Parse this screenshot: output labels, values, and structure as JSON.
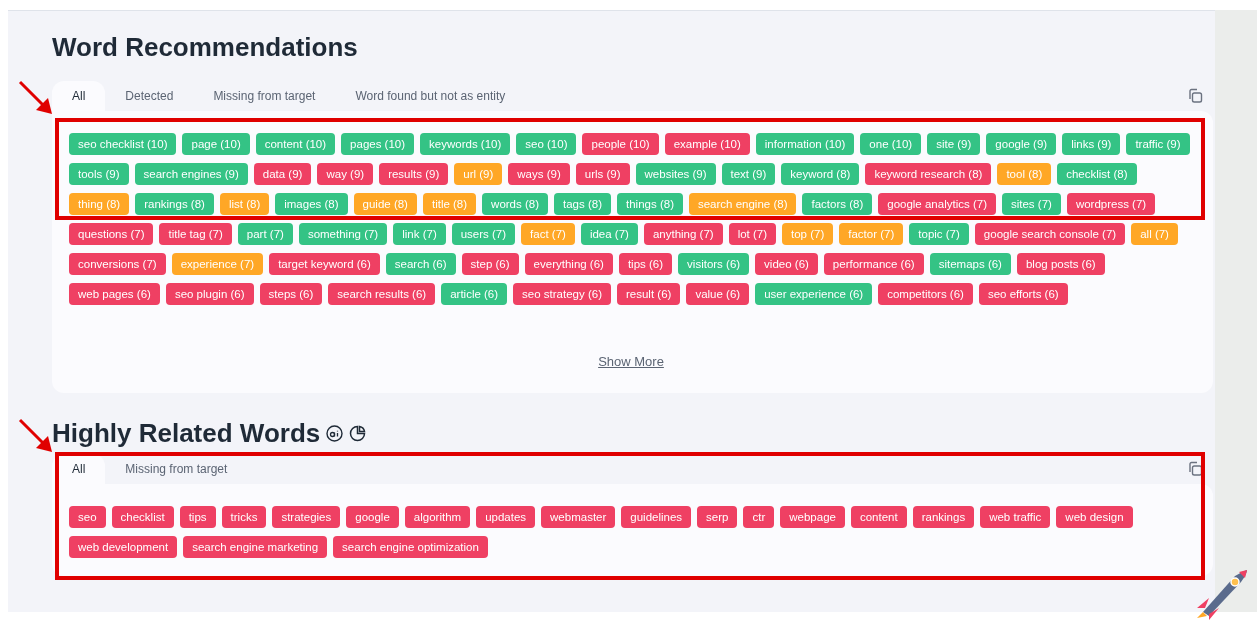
{
  "word_recommendations": {
    "title": "Word Recommendations",
    "tabs": [
      {
        "label": "All",
        "selected": true
      },
      {
        "label": "Detected",
        "selected": false
      },
      {
        "label": "Missing from target",
        "selected": false
      },
      {
        "label": "Word found but not as entity",
        "selected": false
      }
    ],
    "tags": [
      {
        "label": "seo checklist (10)",
        "color": "#34c385"
      },
      {
        "label": "page (10)",
        "color": "#34c385"
      },
      {
        "label": "content (10)",
        "color": "#34c385"
      },
      {
        "label": "pages (10)",
        "color": "#34c385"
      },
      {
        "label": "keywords (10)",
        "color": "#34c385"
      },
      {
        "label": "seo (10)",
        "color": "#34c385"
      },
      {
        "label": "people (10)",
        "color": "#ef4063"
      },
      {
        "label": "example (10)",
        "color": "#ef4063"
      },
      {
        "label": "information (10)",
        "color": "#34c385"
      },
      {
        "label": "one (10)",
        "color": "#34c385"
      },
      {
        "label": "site (9)",
        "color": "#34c385"
      },
      {
        "label": "google (9)",
        "color": "#34c385"
      },
      {
        "label": "links (9)",
        "color": "#34c385"
      },
      {
        "label": "traffic (9)",
        "color": "#34c385"
      },
      {
        "label": "tools (9)",
        "color": "#34c385"
      },
      {
        "label": "search engines (9)",
        "color": "#34c385"
      },
      {
        "label": "data (9)",
        "color": "#ef4063"
      },
      {
        "label": "way (9)",
        "color": "#ef4063"
      },
      {
        "label": "results (9)",
        "color": "#ef4063"
      },
      {
        "label": "url (9)",
        "color": "#ffa726"
      },
      {
        "label": "ways (9)",
        "color": "#ef4063"
      },
      {
        "label": "urls (9)",
        "color": "#ef4063"
      },
      {
        "label": "websites (9)",
        "color": "#34c385"
      },
      {
        "label": "text (9)",
        "color": "#34c385"
      },
      {
        "label": "keyword (8)",
        "color": "#34c385"
      },
      {
        "label": "keyword research (8)",
        "color": "#ef4063"
      },
      {
        "label": "tool (8)",
        "color": "#ffa726"
      },
      {
        "label": "checklist (8)",
        "color": "#34c385"
      },
      {
        "label": "thing (8)",
        "color": "#ffa726"
      },
      {
        "label": "rankings (8)",
        "color": "#34c385"
      },
      {
        "label": "list (8)",
        "color": "#ffa726"
      },
      {
        "label": "images (8)",
        "color": "#34c385"
      },
      {
        "label": "guide (8)",
        "color": "#ffa726"
      },
      {
        "label": "title (8)",
        "color": "#ffa726"
      },
      {
        "label": "words (8)",
        "color": "#34c385"
      },
      {
        "label": "tags (8)",
        "color": "#34c385"
      },
      {
        "label": "things (8)",
        "color": "#34c385"
      },
      {
        "label": "search engine (8)",
        "color": "#ffa726"
      },
      {
        "label": "factors (8)",
        "color": "#34c385"
      },
      {
        "label": "google analytics (7)",
        "color": "#ef4063"
      },
      {
        "label": "sites (7)",
        "color": "#34c385"
      },
      {
        "label": "wordpress (7)",
        "color": "#ef4063"
      },
      {
        "label": "questions (7)",
        "color": "#ef4063"
      },
      {
        "label": "title tag (7)",
        "color": "#ef4063"
      },
      {
        "label": "part (7)",
        "color": "#34c385"
      },
      {
        "label": "something (7)",
        "color": "#34c385"
      },
      {
        "label": "link (7)",
        "color": "#34c385"
      },
      {
        "label": "users (7)",
        "color": "#34c385"
      },
      {
        "label": "fact (7)",
        "color": "#ffa726"
      },
      {
        "label": "idea (7)",
        "color": "#34c385"
      },
      {
        "label": "anything (7)",
        "color": "#ef4063"
      },
      {
        "label": "lot (7)",
        "color": "#ef4063"
      },
      {
        "label": "top (7)",
        "color": "#ffa726"
      },
      {
        "label": "factor (7)",
        "color": "#ffa726"
      },
      {
        "label": "topic (7)",
        "color": "#34c385"
      },
      {
        "label": "google search console (7)",
        "color": "#ef4063"
      },
      {
        "label": "all (7)",
        "color": "#ffa726"
      },
      {
        "label": "conversions (7)",
        "color": "#ef4063"
      },
      {
        "label": "experience (7)",
        "color": "#ffa726"
      },
      {
        "label": "target keyword (6)",
        "color": "#ef4063"
      },
      {
        "label": "search (6)",
        "color": "#34c385"
      },
      {
        "label": "step (6)",
        "color": "#ef4063"
      },
      {
        "label": "everything (6)",
        "color": "#ef4063"
      },
      {
        "label": "tips (6)",
        "color": "#ef4063"
      },
      {
        "label": "visitors (6)",
        "color": "#34c385"
      },
      {
        "label": "video (6)",
        "color": "#ef4063"
      },
      {
        "label": "performance (6)",
        "color": "#ef4063"
      },
      {
        "label": "sitemaps (6)",
        "color": "#34c385"
      },
      {
        "label": "blog posts (6)",
        "color": "#ef4063"
      },
      {
        "label": "web pages (6)",
        "color": "#ef4063"
      },
      {
        "label": "seo plugin (6)",
        "color": "#ef4063"
      },
      {
        "label": "steps (6)",
        "color": "#ef4063"
      },
      {
        "label": "search results (6)",
        "color": "#ef4063"
      },
      {
        "label": "article (6)",
        "color": "#34c385"
      },
      {
        "label": "seo strategy (6)",
        "color": "#ef4063"
      },
      {
        "label": "result (6)",
        "color": "#ef4063"
      },
      {
        "label": "value (6)",
        "color": "#ef4063"
      },
      {
        "label": "user experience (6)",
        "color": "#34c385"
      },
      {
        "label": "competitors (6)",
        "color": "#ef4063"
      },
      {
        "label": "seo efforts (6)",
        "color": "#ef4063"
      }
    ],
    "show_more": "Show More"
  },
  "highly_related_words": {
    "title": "Highly Related Words",
    "tabs": [
      {
        "label": "All",
        "selected": true
      },
      {
        "label": "Missing from target",
        "selected": false
      }
    ],
    "tags": [
      {
        "label": "seo",
        "color": "#ef4063"
      },
      {
        "label": "checklist",
        "color": "#ef4063"
      },
      {
        "label": "tips",
        "color": "#ef4063"
      },
      {
        "label": "tricks",
        "color": "#ef4063"
      },
      {
        "label": "strategies",
        "color": "#ef4063"
      },
      {
        "label": "google",
        "color": "#ef4063"
      },
      {
        "label": "algorithm",
        "color": "#ef4063"
      },
      {
        "label": "updates",
        "color": "#ef4063"
      },
      {
        "label": "webmaster",
        "color": "#ef4063"
      },
      {
        "label": "guidelines",
        "color": "#ef4063"
      },
      {
        "label": "serp",
        "color": "#ef4063"
      },
      {
        "label": "ctr",
        "color": "#ef4063"
      },
      {
        "label": "webpage",
        "color": "#ef4063"
      },
      {
        "label": "content",
        "color": "#ef4063"
      },
      {
        "label": "rankings",
        "color": "#ef4063"
      },
      {
        "label": "web traffic",
        "color": "#ef4063"
      },
      {
        "label": "web design",
        "color": "#ef4063"
      },
      {
        "label": "web development",
        "color": "#ef4063"
      },
      {
        "label": "search engine marketing",
        "color": "#ef4063"
      },
      {
        "label": "search engine optimization",
        "color": "#ef4063"
      }
    ]
  }
}
